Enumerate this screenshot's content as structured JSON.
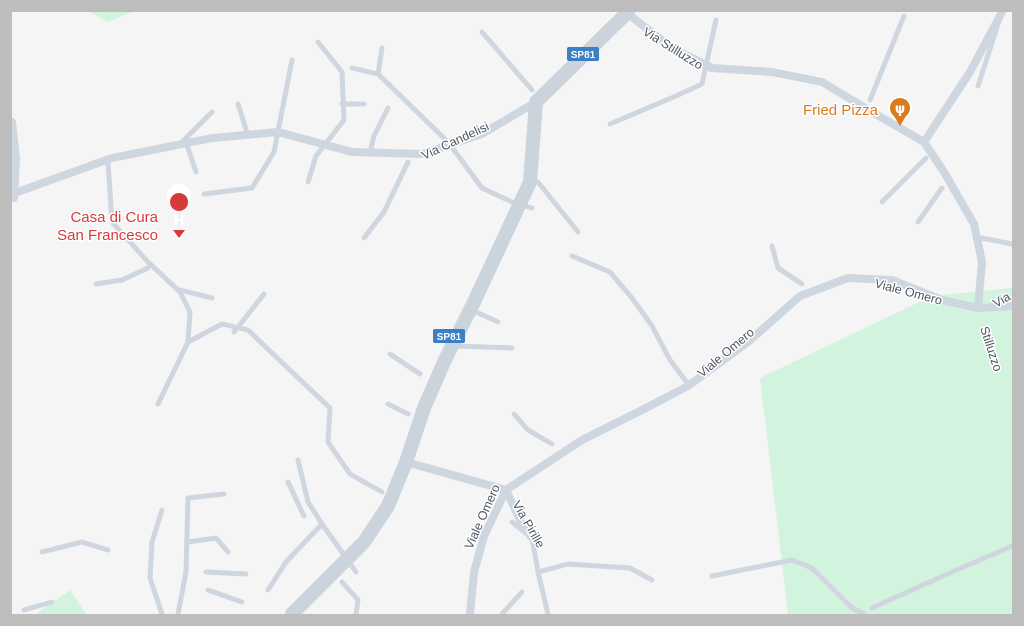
{
  "map": {
    "colors": {
      "background": "#f5f5f5",
      "frame": "#bdbdbd",
      "road": "#cfd6df",
      "park": "#d2f3de",
      "shield": "#3b7fc4",
      "hospital": "#d63b3b",
      "food": "#d97a1b"
    },
    "streets": {
      "via_stilluzzo": "Via Stilluzzo",
      "via_candelisi": "Via Candelisi",
      "viale_omero_a": "Viale Omero",
      "viale_omero_b": "Viale Omero",
      "viale_omero_c": "Viale Omero",
      "via_pirille": "Via Pirille",
      "stilluzzo_vertical": "Stilluzzo",
      "via_edge": "Via"
    },
    "route_shields": {
      "top": "SP81",
      "middle": "SP81"
    },
    "pois": {
      "hospital": {
        "name_line1": "Casa di Cura",
        "name_line2": "San Francesco",
        "icon": "hospital-icon",
        "glyph": "H"
      },
      "restaurant": {
        "name": "Fried Pizza",
        "icon": "restaurant-icon",
        "glyph": "ψ"
      }
    }
  }
}
